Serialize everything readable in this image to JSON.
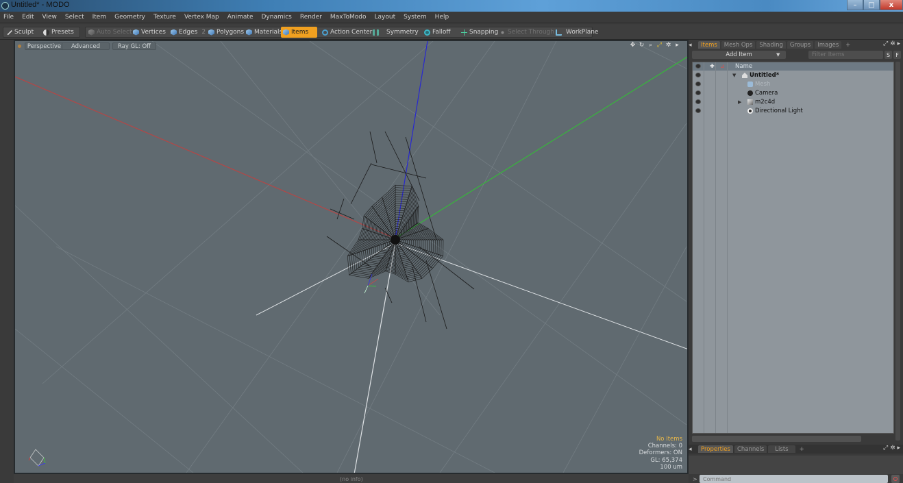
{
  "window": {
    "title": "Untitled* - MODO",
    "minimize": "–",
    "maximize": "□",
    "close": "x"
  },
  "menu": [
    "File",
    "Edit",
    "View",
    "Select",
    "Item",
    "Geometry",
    "Texture",
    "Vertex Map",
    "Animate",
    "Dynamics",
    "Render",
    "MaxToModo",
    "Layout",
    "System",
    "Help"
  ],
  "toolbar": {
    "sculpt": "Sculpt",
    "presets": "Presets",
    "auto_select": "Auto Select",
    "vertices": "Vertices",
    "edges": "Edges",
    "edges_count": "2",
    "polygons": "Polygons",
    "materials": "Materials",
    "items": "Items",
    "action_center": "Action Center",
    "symmetry": "Symmetry",
    "falloff": "Falloff",
    "snapping": "Snapping",
    "select_through": "Select Through",
    "workplane": "WorkPlane"
  },
  "viewport": {
    "tabs": [
      "Perspective",
      "Advanced",
      "Ray GL: Off"
    ],
    "info": {
      "selection": "No Items",
      "channels": "Channels: 0",
      "deformers": "Deformers: ON",
      "gl": "GL: 65,374",
      "scale": "100 um"
    },
    "axis_colors": {
      "x": "#c04040",
      "y": "#3cc040",
      "z": "#3030d0"
    },
    "status": "(no info)"
  },
  "items_panel": {
    "tabs": [
      "Items",
      "Mesh Ops",
      "Shading",
      "Groups",
      "Images",
      "+"
    ],
    "add_item": "Add Item",
    "filter_placeholder": "Filter Items",
    "s_button": "S",
    "f_button": "F",
    "column_name": "Name",
    "rows": [
      {
        "label": "Untitled*",
        "style": "bold",
        "expander": "▼"
      },
      {
        "label": "Mesh",
        "style": "dim",
        "expander": ""
      },
      {
        "label": "Camera",
        "style": "normal",
        "expander": ""
      },
      {
        "label": "m2c4d",
        "style": "normal",
        "expander": "▶"
      },
      {
        "label": "Directional Light",
        "style": "normal",
        "expander": ""
      }
    ]
  },
  "props_panel": {
    "tabs": [
      "Properties",
      "Channels",
      "Lists",
      "+"
    ]
  },
  "command": {
    "prompt": ">",
    "placeholder": "Command"
  },
  "accent": "#f0a020"
}
